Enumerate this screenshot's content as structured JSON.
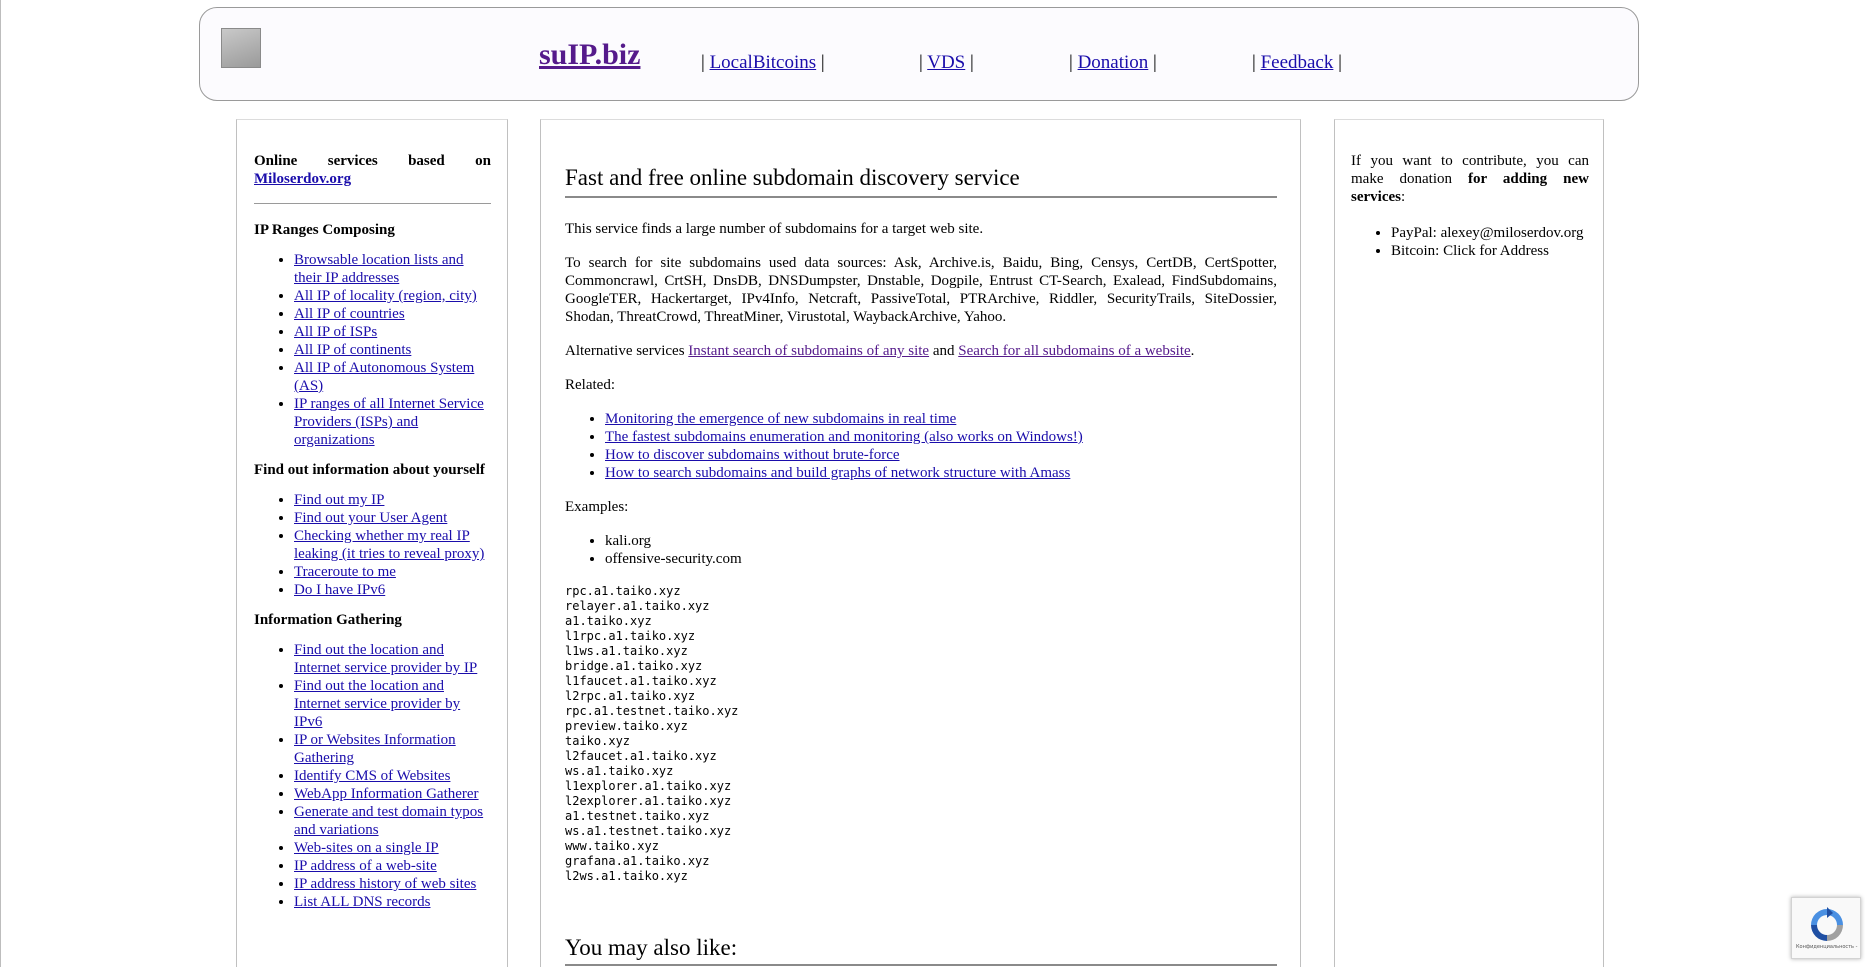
{
  "header": {
    "site_title": "suIP.biz",
    "nav": [
      {
        "label": "LocalBitcoins"
      },
      {
        "label": "VDS"
      },
      {
        "label": "Donation"
      },
      {
        "label": "Feedback"
      }
    ],
    "separator": "|"
  },
  "sidebar": {
    "intro_text": "Online services based on",
    "intro_link": "Miloserdov.org",
    "sections": [
      {
        "heading": "IP Ranges Composing",
        "links": [
          "Browsable location lists and their IP addresses",
          "All IP of locality (region, city)",
          "All IP of countries",
          "All IP of ISPs",
          "All IP of continents",
          "All IP of Autonomous System (AS)",
          "IP ranges of all Internet Service Providers (ISPs) and organizations"
        ]
      },
      {
        "heading": "Find out information about yourself",
        "links": [
          "Find out my IP",
          "Find out your User Agent",
          "Checking whether my real IP leaking (it tries to reveal proxy)",
          "Traceroute to me",
          "Do I have IPv6"
        ]
      },
      {
        "heading": "Information Gathering",
        "links": [
          "Find out the location and Internet service provider by IP",
          "Find out the location and Internet service provider by IPv6",
          "IP or Websites Information Gathering",
          "Identify CMS of Websites",
          "WebApp Information Gatherer",
          "Generate and test domain typos and variations",
          "Web-sites on a single IP",
          "IP address of a web-site",
          "IP address history of web sites",
          "List ALL DNS records"
        ]
      }
    ]
  },
  "main": {
    "title": "Fast and free online subdomain discovery service",
    "description": "This service finds a large number of subdomains for a target web site.",
    "sources_text": "To search for site subdomains used data sources: Ask, Archive.is, Baidu, Bing, Censys, CertDB, CertSpotter, Commoncrawl, CrtSH, DnsDB, DNSDumpster, Dnstable, Dogpile, Entrust CT-Search, Exalead, FindSubdomains, GoogleTER, Hackertarget, IPv4Info, Netcraft, PassiveTotal, PTRArchive, Riddler, SecurityTrails, SiteDossier, Shodan, ThreatCrowd, ThreatMiner, Virustotal, WaybackArchive, Yahoo.",
    "alt_prefix": "Alternative services",
    "alt_link_1": "Instant search of subdomains of any site",
    "alt_and": "and",
    "alt_link_2": "Search for all subdomains of a website",
    "alt_suffix": ".",
    "related_label": "Related:",
    "related_links": [
      "Monitoring the emergence of new subdomains in real time",
      "The fastest subdomains enumeration and monitoring (also works on Windows!)",
      "How to discover subdomains without brute-force",
      "How to search subdomains and build graphs of network structure with Amass"
    ],
    "examples_label": "Examples:",
    "examples": [
      "kali.org",
      "offensive-security.com"
    ],
    "results": [
      "rpc.a1.taiko.xyz",
      "relayer.a1.taiko.xyz",
      "a1.taiko.xyz",
      "l1rpc.a1.taiko.xyz",
      "l1ws.a1.taiko.xyz",
      "bridge.a1.taiko.xyz",
      "l1faucet.a1.taiko.xyz",
      "l2rpc.a1.taiko.xyz",
      "rpc.a1.testnet.taiko.xyz",
      "preview.taiko.xyz",
      "taiko.xyz",
      "l2faucet.a1.taiko.xyz",
      "ws.a1.taiko.xyz",
      "l1explorer.a1.taiko.xyz",
      "l2explorer.a1.taiko.xyz",
      "a1.testnet.taiko.xyz",
      "ws.a1.testnet.taiko.xyz",
      "www.taiko.xyz",
      "grafana.a1.taiko.xyz",
      "l2ws.a1.taiko.xyz"
    ],
    "also_like": "You may also like:"
  },
  "right": {
    "contribute_pre": "If you want to contribute, you can make donation",
    "contribute_bold": "for adding new services",
    "contribute_post": ":",
    "items": [
      "PayPal: alexey@miloserdov.org",
      "Bitcoin: Click for Address"
    ]
  },
  "recaptcha": {
    "text": "Конфиденциальность - Условия использования",
    "icon": "recaptcha-icon"
  },
  "colors": {
    "link": "#1a0dab",
    "visited": "#551a8b",
    "border": "#9a9a9a"
  }
}
